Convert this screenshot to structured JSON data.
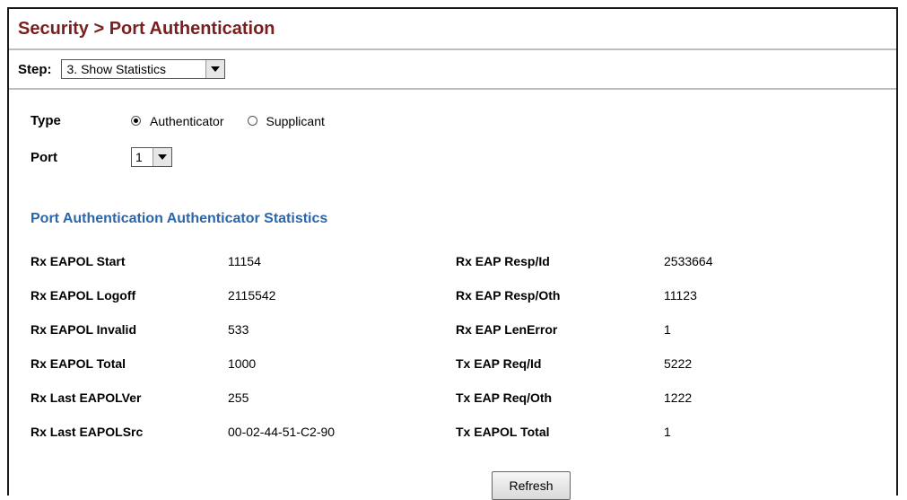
{
  "header": {
    "title": "Security > Port Authentication"
  },
  "step": {
    "label": "Step:",
    "selected": "3. Show Statistics"
  },
  "form": {
    "type_label": "Type",
    "type_options": [
      {
        "label": "Authenticator",
        "checked": true
      },
      {
        "label": "Supplicant",
        "checked": false
      }
    ],
    "port_label": "Port",
    "port_selected": "1"
  },
  "section_title": "Port Authentication Authenticator Statistics",
  "stats": [
    {
      "k1": "Rx EAPOL Start",
      "v1": "11154",
      "k2": "Rx EAP Resp/Id",
      "v2": "2533664"
    },
    {
      "k1": "Rx EAPOL Logoff",
      "v1": "2115542",
      "k2": "Rx EAP Resp/Oth",
      "v2": "11123"
    },
    {
      "k1": "Rx EAPOL Invalid",
      "v1": "533",
      "k2": "Rx EAP LenError",
      "v2": "1"
    },
    {
      "k1": "Rx EAPOL Total",
      "v1": "1000",
      "k2": "Tx EAP Req/Id",
      "v2": "5222"
    },
    {
      "k1": "Rx Last EAPOLVer",
      "v1": "255",
      "k2": "Tx EAP Req/Oth",
      "v2": "1222"
    },
    {
      "k1": "Rx Last EAPOLSrc",
      "v1": "00-02-44-51-C2-90",
      "k2": "Tx EAPOL Total",
      "v2": "1"
    }
  ],
  "refresh_label": "Refresh"
}
